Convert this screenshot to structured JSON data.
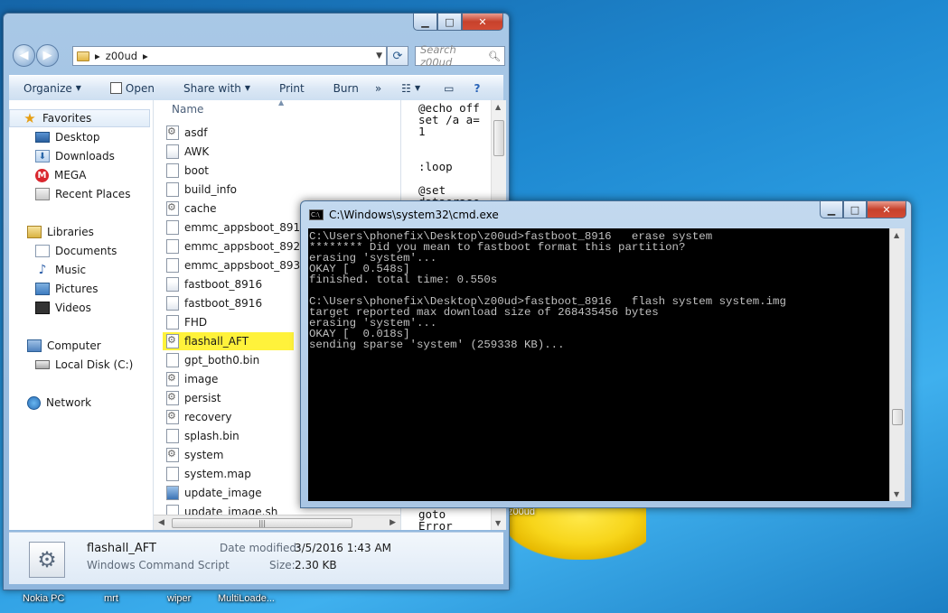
{
  "desktop": {
    "taskbar_icons": [
      "Nokia PC",
      "mrt",
      "wiper",
      "MultiLoade..."
    ],
    "folder_label": "z00ud"
  },
  "explorer": {
    "address": {
      "path": "z00ud"
    },
    "search_placeholder": "Search z00ud",
    "toolbar": {
      "organize": "Organize",
      "open": "Open",
      "share_with": "Share with",
      "print": "Print",
      "burn": "Burn",
      "more": "»"
    },
    "nav": {
      "favorites": "Favorites",
      "desktop": "Desktop",
      "downloads": "Downloads",
      "mega": "MEGA",
      "recent": "Recent Places",
      "libraries": "Libraries",
      "documents": "Documents",
      "music": "Music",
      "pictures": "Pictures",
      "videos": "Videos",
      "computer": "Computer",
      "local_disk": "Local Disk (C:)",
      "network": "Network"
    },
    "column_name": "Name",
    "files": [
      "asdf",
      "AWK",
      "boot",
      "build_info",
      "cache",
      "emmc_appsboot_8916.r",
      "emmc_appsboot_8929.r",
      "emmc_appsboot_8939.r",
      "fastboot_8916",
      "fastboot_8916",
      "FHD",
      "flashall_AFT",
      "gpt_both0.bin",
      "image",
      "persist",
      "recovery",
      "splash.bin",
      "system",
      "system.map",
      "update_image",
      "update_image.sh"
    ],
    "selected_file": "flashall_AFT",
    "preview_text": "@echo off\nset /a a=\n1\n\n\n:loop\n\n@set\ndataerase",
    "preview_tail": "goto\nError",
    "details": {
      "name": "flashall_AFT",
      "type": "Windows Command Script",
      "date_label": "Date modified:",
      "date_value": "3/5/2016 1:43 AM",
      "size_label": "Size:",
      "size_value": "2.30 KB"
    }
  },
  "cmd": {
    "title": "C:\\Windows\\system32\\cmd.exe",
    "output": "C:\\Users\\phonefix\\Desktop\\z00ud>fastboot_8916   erase system\n******** Did you mean to fastboot format this partition?\nerasing 'system'...\nOKAY [  0.548s]\nfinished. total time: 0.550s\n\nC:\\Users\\phonefix\\Desktop\\z00ud>fastboot_8916   flash system system.img\ntarget reported max download size of 268435456 bytes\nerasing 'system'...\nOKAY [  0.018s]\nsending sparse 'system' (259338 KB)..."
  }
}
